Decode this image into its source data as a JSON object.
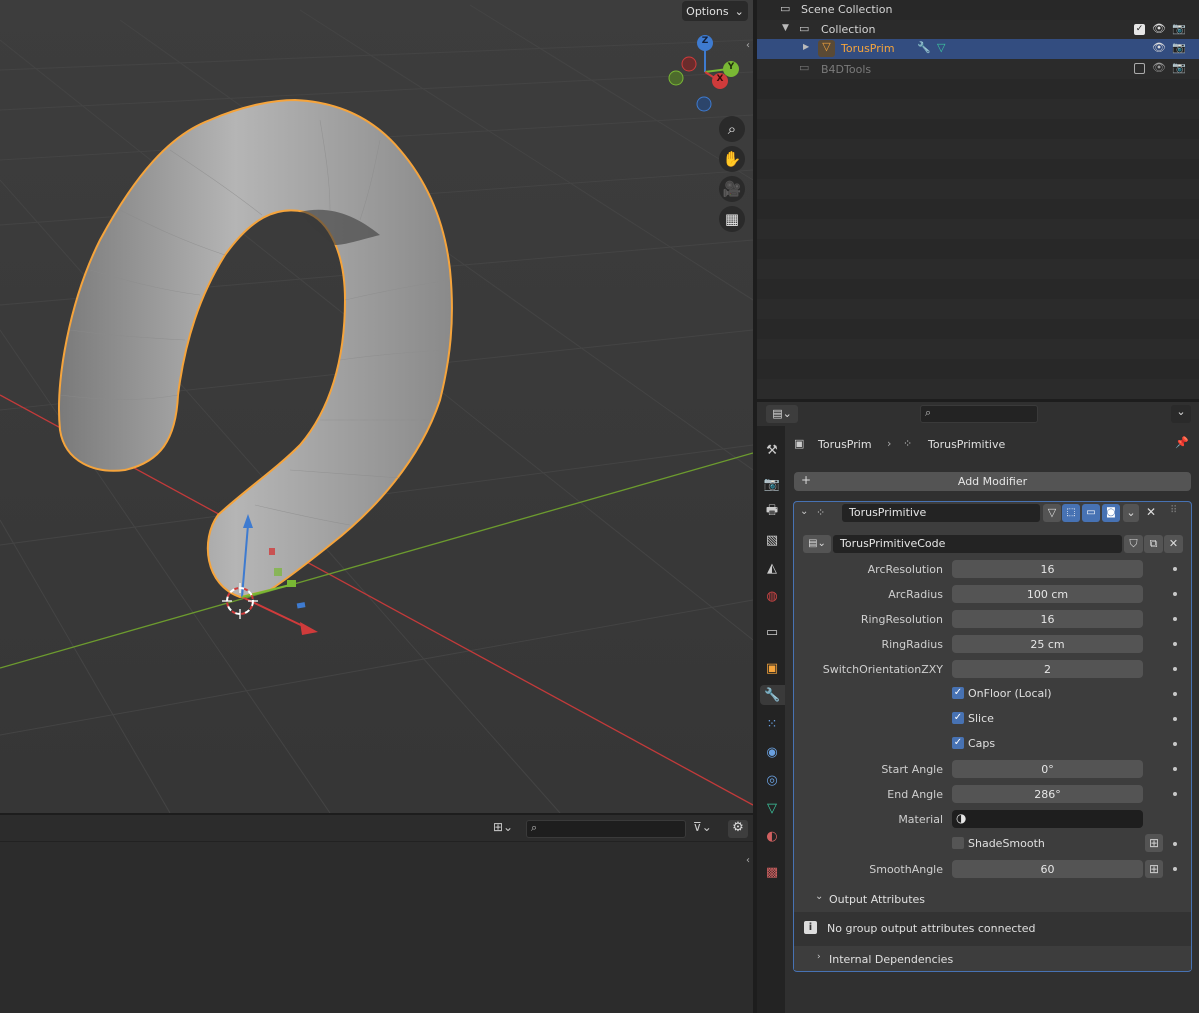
{
  "viewport": {
    "options_label": "Options",
    "gizmo": {
      "z": "Z",
      "y": "Y",
      "x": "X"
    },
    "nav_icons": [
      "zoom-icon",
      "hand-pan-icon",
      "camera-icon",
      "grid-perspective-icon"
    ]
  },
  "outliner": {
    "rows": [
      {
        "label": "Scene Collection"
      },
      {
        "label": "Collection"
      },
      {
        "label": "TorusPrim"
      },
      {
        "label": "B4DTools"
      }
    ]
  },
  "properties": {
    "breadcrumb": {
      "object": "TorusPrim",
      "modifier": "TorusPrimitive"
    },
    "add_modifier": "Add Modifier",
    "modifier_name": "TorusPrimitive",
    "node_group": "TorusPrimitiveCode",
    "fields": [
      {
        "label": "ArcResolution",
        "value": "16"
      },
      {
        "label": "ArcRadius",
        "value": "100 cm"
      },
      {
        "label": "RingResolution",
        "value": "16"
      },
      {
        "label": "RingRadius",
        "value": "25 cm"
      },
      {
        "label": "SwitchOrientationZXY",
        "value": "2"
      }
    ],
    "checks": [
      {
        "label": "OnFloor (Local)",
        "checked": true
      },
      {
        "label": "Slice",
        "checked": true
      },
      {
        "label": "Caps",
        "checked": true
      }
    ],
    "angles": [
      {
        "label": "Start Angle",
        "value": "0°"
      },
      {
        "label": "End Angle",
        "value": "286°"
      }
    ],
    "material_label": "Material",
    "shade_smooth": {
      "label": "ShadeSmooth",
      "checked": false
    },
    "smooth_angle": {
      "label": "SmoothAngle",
      "value": "60"
    },
    "output_attributes": "Output Attributes",
    "no_output_msg": "No group output attributes connected",
    "internal_deps": "Internal Dependencies"
  },
  "colors": {
    "selection_orange": "#f5a43c",
    "active_blue": "#4772b3",
    "x_axis": "#d03b3b",
    "y_axis": "#79b834"
  }
}
